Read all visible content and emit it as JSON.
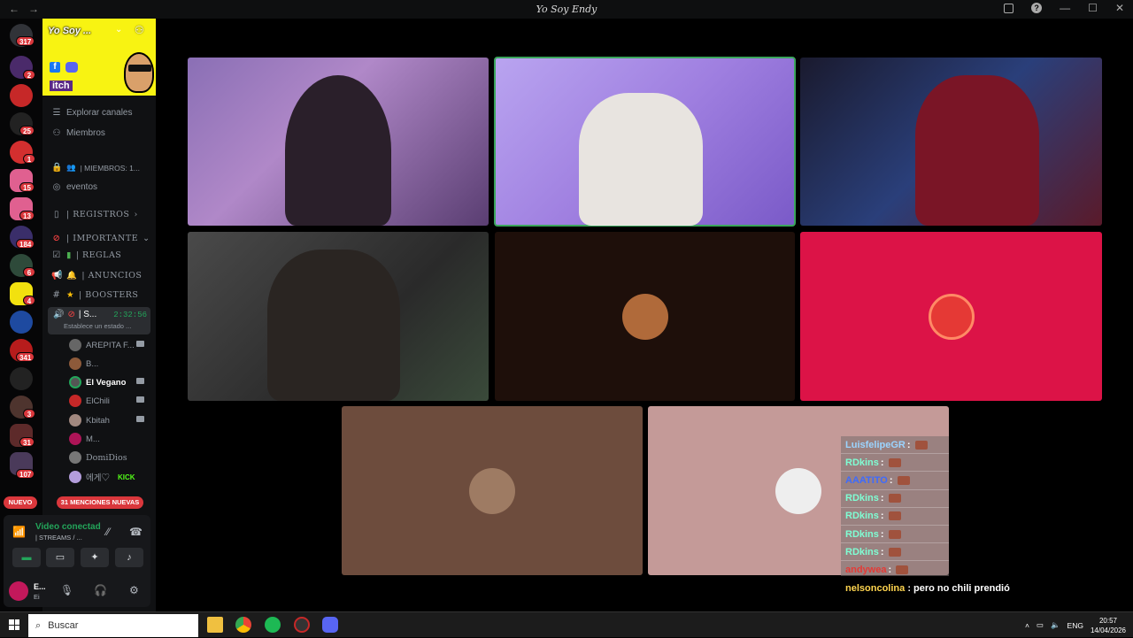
{
  "window": {
    "title": "Yo Soy Endy"
  },
  "server_bar": {
    "badges": [
      "317",
      "2",
      "25",
      "1",
      "15",
      "13",
      "184",
      "6",
      "4",
      "341",
      "3",
      "31",
      "107"
    ],
    "new_label": "NUEVO"
  },
  "sidebar": {
    "server_name": "Yo Soy ...",
    "banner_text": "itch",
    "channels": {
      "browse": "Explorar canales",
      "members": "Miembros",
      "member_count": "| MIEMBROS: 1...",
      "events": "eventos",
      "registros": "| REGISTROS",
      "importante": "| IMPORTANTE",
      "reglas": "| REGLAS",
      "anuncios": "| ANUNCIOS",
      "boosters": "| BOOSTERS"
    },
    "active_voice": {
      "name": "| S...",
      "time": "2:32:56",
      "status": "Establece un estado ..."
    },
    "voice_members": [
      "AREPITA F...",
      "B...",
      "El Vegano",
      "ElChili",
      "Kbitah",
      "M...",
      "DomiDios",
      "에게♡"
    ],
    "kick_label": "KICK",
    "mentions": "31 MENCIONES NUEVAS"
  },
  "voice_panel": {
    "status": "Video conectad",
    "channel": "| STREAMS / ..."
  },
  "user": {
    "name": "E...",
    "status": "Ei"
  },
  "chat": {
    "rows": [
      {
        "user": "LuisfelipeGR",
        "color": "#9bd4ff"
      },
      {
        "user": "RDkins",
        "color": "#7fffd4"
      },
      {
        "user": "AAATITO",
        "color": "#3d6bff"
      },
      {
        "user": "RDkins",
        "color": "#7fffd4"
      },
      {
        "user": "RDkins",
        "color": "#7fffd4"
      },
      {
        "user": "RDkins",
        "color": "#7fffd4"
      },
      {
        "user": "RDkins",
        "color": "#7fffd4"
      },
      {
        "user": "andywea",
        "color": "#e53935"
      }
    ],
    "sep": " :",
    "last": {
      "user": "nelsoncolina",
      "text": ": pero no chili prendió",
      "color": "#ffd54f"
    }
  },
  "taskbar": {
    "search": "Buscar",
    "lang": "ENG",
    "time": "20:57",
    "date": "14/04/2026"
  },
  "colors": {
    "accent_green": "#23a55a",
    "red": "#da373c",
    "discord": "#5865f2"
  }
}
